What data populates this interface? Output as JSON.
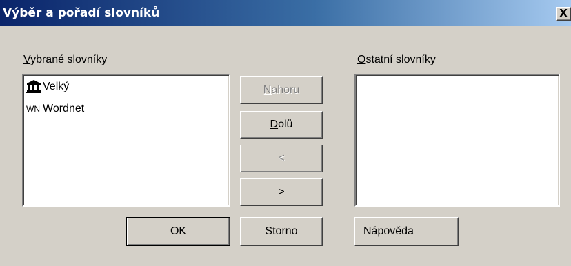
{
  "window": {
    "title": "Výběr a pořadí slovníků",
    "close_glyph": "X"
  },
  "selected": {
    "label_accel": "V",
    "label_rest": "ybrané slovníky",
    "items": [
      {
        "icon": "building-icon",
        "icon_text": "🏛",
        "label": "Velký"
      },
      {
        "icon": "wordnet-icon",
        "icon_text": "WN",
        "label": "Wordnet"
      }
    ]
  },
  "others": {
    "label_accel": "O",
    "label_rest": "statní slovníky",
    "items": []
  },
  "buttons": {
    "up": {
      "accel": "N",
      "rest": "ahoru",
      "enabled": false
    },
    "down": {
      "accel": "D",
      "rest": "olů",
      "enabled": true
    },
    "left": {
      "label": "<",
      "enabled": false
    },
    "right": {
      "label": ">",
      "enabled": true
    },
    "ok": {
      "label": "OK",
      "default": true
    },
    "cancel": {
      "label": "Storno"
    },
    "help": {
      "label": "Nápověda"
    }
  }
}
